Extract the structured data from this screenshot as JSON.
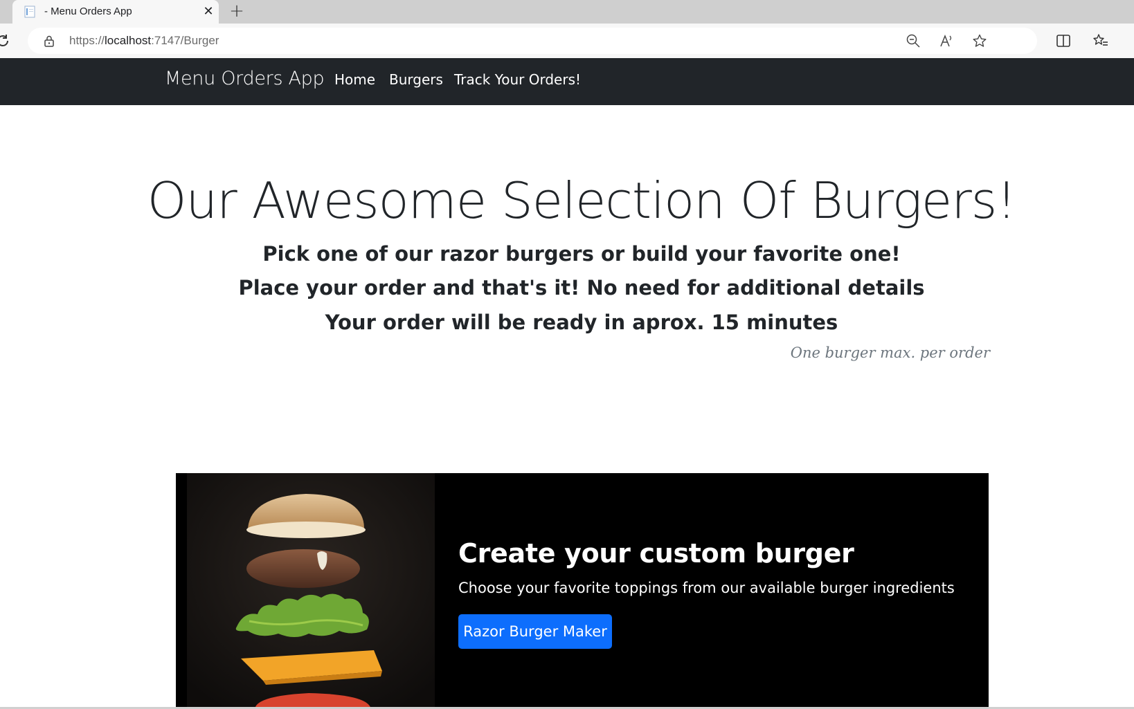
{
  "browser": {
    "tab_title": "- Menu Orders App",
    "url_scheme": "https://",
    "url_host": "localhost",
    "url_path": ":7147/Burger",
    "icons": [
      "reload-icon",
      "lock-icon",
      "zoom-out-icon",
      "read-aloud-icon",
      "favorite-star-icon",
      "split-screen-icon",
      "favorites-list-icon"
    ]
  },
  "navbar": {
    "brand": "Menu Orders App",
    "links": [
      "Home",
      "Burgers",
      "Track Your Orders!"
    ],
    "background": "#212529"
  },
  "hero": {
    "title": "Our Awesome Selection Of Burgers!",
    "lines": [
      "Pick one of our razor burgers or build your favorite one!",
      "Place your order and that's it! No need for additional details",
      "Your order will be ready in aprox. 15 minutes"
    ],
    "note": "One burger max. per order"
  },
  "card": {
    "title": "Create your custom burger",
    "text": "Choose your favorite toppings from our available burger ingredients",
    "button_label": "Razor Burger Maker",
    "button_color": "#0d6efd",
    "image": "burger-ingredients-image"
  }
}
